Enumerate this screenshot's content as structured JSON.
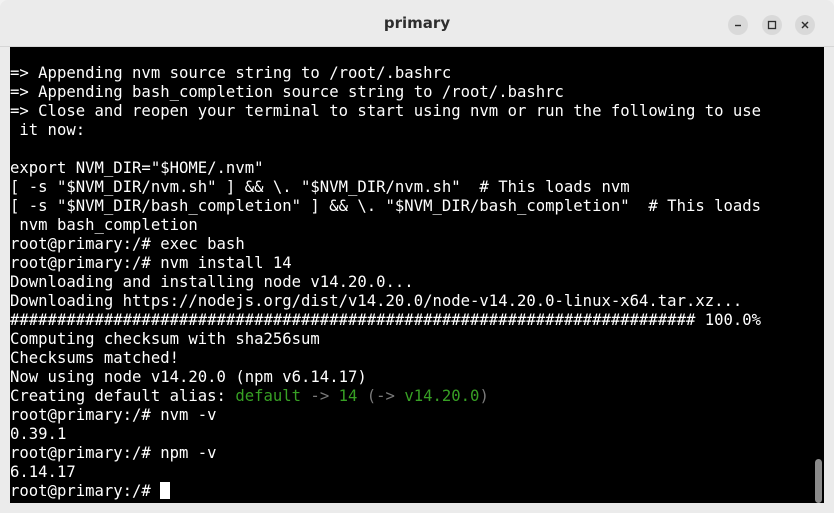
{
  "window": {
    "title": "primary",
    "controls": {
      "minimize_icon": "minimize-icon",
      "maximize_icon": "maximize-icon",
      "close_icon": "close-icon"
    }
  },
  "terminal": {
    "lines": [
      "=> Appending nvm source string to /root/.bashrc",
      "=> Appending bash_completion source string to /root/.bashrc",
      "=> Close and reopen your terminal to start using nvm or run the following to use",
      " it now:",
      "",
      "export NVM_DIR=\"$HOME/.nvm\"",
      "[ -s \"$NVM_DIR/nvm.sh\" ] && \\. \"$NVM_DIR/nvm.sh\"  # This loads nvm",
      "[ -s \"$NVM_DIR/bash_completion\" ] && \\. \"$NVM_DIR/bash_completion\"  # This loads",
      " nvm bash_completion",
      "root@primary:/# exec bash",
      "root@primary:/# nvm install 14",
      "Downloading and installing node v14.20.0...",
      "Downloading https://nodejs.org/dist/v14.20.0/node-v14.20.0-linux-x64.tar.xz...",
      "######################################################################### 100.0%",
      "Computing checksum with sha256sum",
      "Checksums matched!",
      "Now using node v14.20.0 (npm v6.14.17)",
      "Creating default alias: ",
      "root@primary:/# nvm -v",
      "0.39.1",
      "root@primary:/# npm -v",
      "6.14.17"
    ],
    "alias_line": {
      "name": "default",
      "arrow1": " -> ",
      "version": "14",
      "open": " (",
      "arrow2": "-> ",
      "resolved": "v14.20.0",
      "close": ")",
      "name_color": "#37a024"
    },
    "prompt": "root@primary:/# "
  }
}
